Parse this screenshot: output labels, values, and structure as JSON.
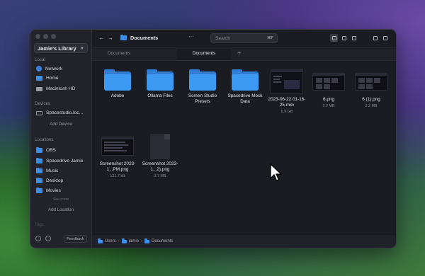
{
  "sidebar": {
    "library": "Jamie's Library",
    "sections": {
      "local": "Local",
      "devices": "Devices",
      "locations": "Locations",
      "tags": "Tags"
    },
    "local_items": [
      "Network",
      "Home",
      "Macintosh HD"
    ],
    "device_items": [
      "Spacestudio.loc..."
    ],
    "add_device": "Add Device",
    "location_items": [
      "OBS",
      "Spacedrive Jamie",
      "Music",
      "Desktop",
      "Movies"
    ],
    "see_more": "See more",
    "add_location": "Add Location",
    "feedback": "Feedback"
  },
  "toolbar": {
    "back": "←",
    "forward": "→",
    "title": "Documents",
    "more": "···",
    "search_placeholder": "Search",
    "search_shortcut": "⌘F"
  },
  "tabs": [
    "Documents",
    "Documents"
  ],
  "active_tab_index": 1,
  "items": [
    {
      "name": "Adobe",
      "kind": "folder"
    },
    {
      "name": "Ollama Files",
      "kind": "folder"
    },
    {
      "name": "Screen Studio Presets",
      "kind": "folder"
    },
    {
      "name": "Spacedrive Mock Data",
      "kind": "folder"
    },
    {
      "name": "2023-06-22 01-16-25.mkv",
      "kind": "video",
      "size": "6.9 GB"
    },
    {
      "name": "6.png",
      "kind": "image",
      "size": "2.2 MB"
    },
    {
      "name": "6 (1).png",
      "kind": "image",
      "size": "2.2 MB"
    },
    {
      "name": "Screenshot 2023-1...PM.png",
      "kind": "image",
      "size": "121.7 kB"
    },
    {
      "name": "Screenshot 2023-1...2).png",
      "kind": "doc",
      "size": "3.7 MB"
    }
  ],
  "breadcrumbs": [
    "Users",
    "jamie",
    "Documents"
  ],
  "colors": {
    "accent": "#3d9af3",
    "window_bg": "#1b1b22",
    "sidebar_bg": "#22222b"
  }
}
